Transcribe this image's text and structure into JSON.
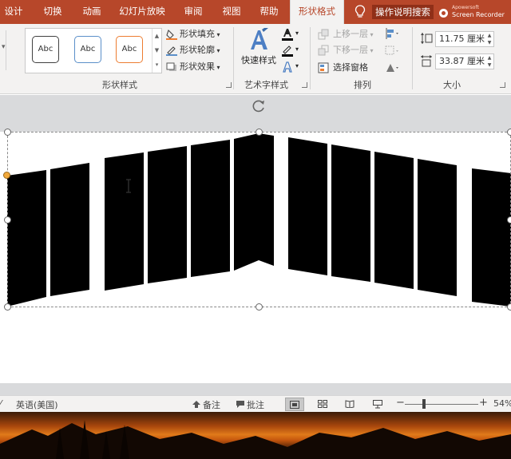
{
  "tabs": [
    {
      "label": "设计"
    },
    {
      "label": "切换"
    },
    {
      "label": "动画"
    },
    {
      "label": "幻灯片放映"
    },
    {
      "label": "审阅"
    },
    {
      "label": "视图"
    },
    {
      "label": "帮助"
    },
    {
      "label": "形状格式",
      "active": true
    }
  ],
  "tell_me": "操作说明搜索",
  "recorder": {
    "line1": "Apowersoft",
    "line2": "Screen Recorder"
  },
  "ribbon": {
    "shape_styles": {
      "presets": [
        "Abc",
        "Abc",
        "Abc"
      ],
      "preset_colors": [
        "#404040",
        "#5b8fc9",
        "#ed7d31"
      ],
      "fill": "形状填充",
      "outline": "形状轮廓",
      "effects": "形状效果",
      "label": "形状样式"
    },
    "wordart": {
      "quick_styles": "快速样式",
      "label": "艺术字样式"
    },
    "arrange": {
      "bring_forward": "上移一层",
      "send_backward": "下移一层",
      "selection_pane": "选择窗格",
      "label": "排列"
    },
    "size": {
      "height": "11.75 厘米",
      "width": "33.87 厘米",
      "label": "大小"
    }
  },
  "status": {
    "language": "英语(美国)",
    "notes": "备注",
    "comments": "批注",
    "zoom": "54%"
  },
  "colors": {
    "accent": "#b7472a",
    "ribbon_bg": "#f3f2f1",
    "panel_fill": "#000000"
  }
}
